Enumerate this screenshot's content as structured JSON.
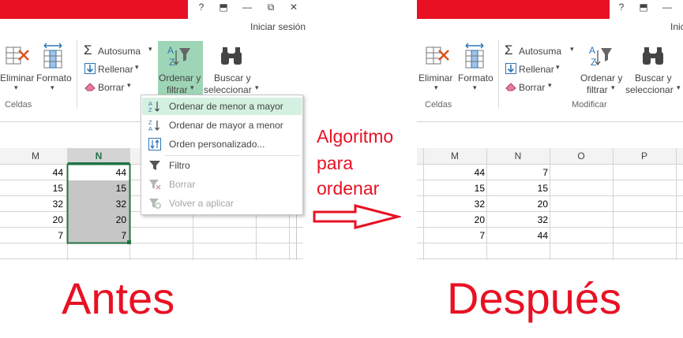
{
  "left": {
    "window_controls": [
      "?",
      "⬒",
      "—",
      "⧉",
      "✕"
    ],
    "sign_in": "Iniciar sesión",
    "ribbon": {
      "eliminar": "Eliminar",
      "formato": "Formato",
      "celdas_group": "Celdas",
      "autosuma": "Autosuma",
      "rellenar": "Rellenar",
      "borrar": "Borrar",
      "ordenar_line1": "Ordenar y",
      "ordenar_line2": "filtrar",
      "buscar_line1": "Buscar y",
      "buscar_line2": "seleccionar"
    },
    "columns": [
      "M",
      "N"
    ],
    "rows": [
      {
        "m": "44",
        "n": "44"
      },
      {
        "m": "15",
        "n": "15"
      },
      {
        "m": "32",
        "n": "32"
      },
      {
        "m": "20",
        "n": "20"
      },
      {
        "m": "7",
        "n": "7"
      }
    ],
    "menu": [
      {
        "label": "Ordenar de menor a mayor",
        "icon": "sort-ascending-icon",
        "state": "highlighted"
      },
      {
        "label": "Ordenar de mayor a menor",
        "icon": "sort-descending-icon",
        "state": "normal"
      },
      {
        "label": "Orden personalizado...",
        "icon": "custom-sort-icon",
        "state": "normal"
      },
      {
        "label": "Filtro",
        "icon": "filter-icon",
        "state": "normal"
      },
      {
        "label": "Borrar",
        "icon": "clear-filter-icon",
        "state": "disabled"
      },
      {
        "label": "Volver a aplicar",
        "icon": "reapply-filter-icon",
        "state": "disabled"
      }
    ],
    "caption": "Antes"
  },
  "middle": {
    "line1": "Algoritmo",
    "line2": "para",
    "line3": "ordenar"
  },
  "right": {
    "window_controls": [
      "?",
      "⬒",
      "—"
    ],
    "sign_in": "Iniciar",
    "ribbon": {
      "eliminar": "Eliminar",
      "formato": "Formato",
      "celdas_group": "Celdas",
      "autosuma": "Autosuma",
      "rellenar": "Rellenar",
      "borrar": "Borrar",
      "ordenar_line1": "Ordenar y",
      "ordenar_line2": "filtrar",
      "buscar_line1": "Buscar y",
      "buscar_line2": "seleccionar",
      "modificar_group": "Modificar"
    },
    "columns": [
      "M",
      "N",
      "O",
      "P"
    ],
    "rows": [
      {
        "m": "44",
        "n": "7"
      },
      {
        "m": "15",
        "n": "15"
      },
      {
        "m": "32",
        "n": "20"
      },
      {
        "m": "20",
        "n": "32"
      },
      {
        "m": "7",
        "n": "44"
      }
    ],
    "caption": "Después"
  },
  "colors": {
    "title_red": "#e81123",
    "caption_red": "#e81123",
    "selection_green": "#217346",
    "menu_highlight": "#d3f0e0"
  }
}
